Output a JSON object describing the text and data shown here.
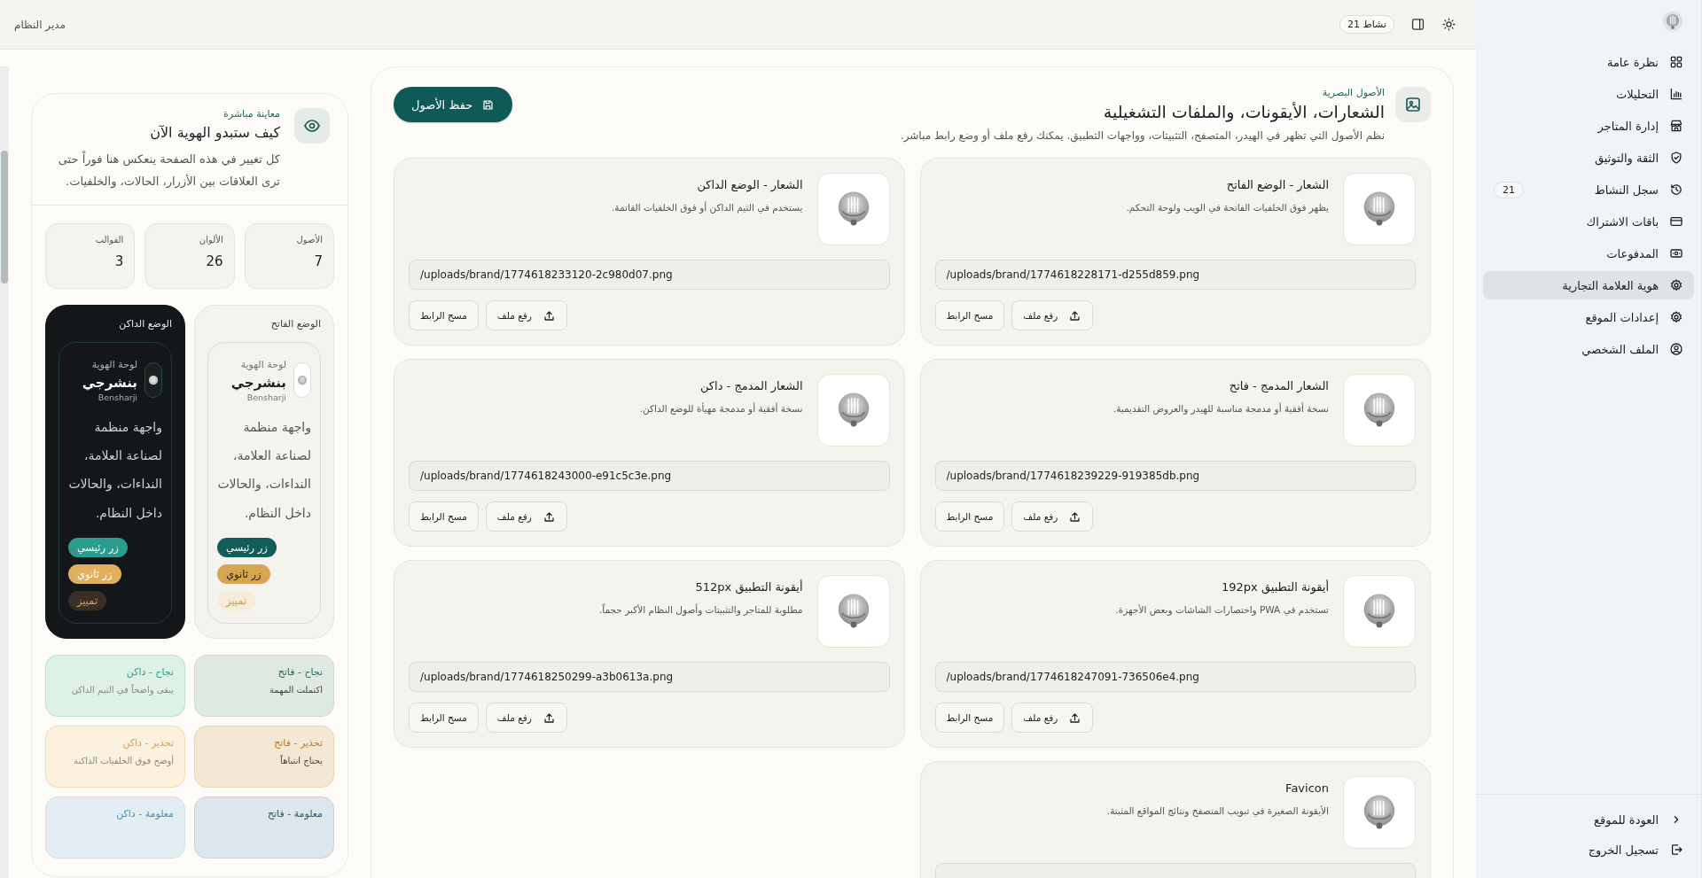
{
  "topbar": {
    "role": "مدير النظام",
    "activity_badge": "نشاط 21"
  },
  "sidebar": {
    "items": [
      {
        "label": "نظرة عامة",
        "selected": false
      },
      {
        "label": "التحليلات",
        "selected": false
      },
      {
        "label": "إدارة المتاجر",
        "selected": false
      },
      {
        "label": "الثقة والتوثيق",
        "selected": false
      },
      {
        "label": "سجل النشاط",
        "selected": false,
        "badge": "21"
      },
      {
        "label": "باقات الاشتراك",
        "selected": false
      },
      {
        "label": "المدفوعات",
        "selected": false
      },
      {
        "label": "هوية العلامة التجارية",
        "selected": true
      },
      {
        "label": "إعدادات الموقع",
        "selected": false
      },
      {
        "label": "الملف الشخصي",
        "selected": false
      }
    ],
    "footer": [
      {
        "label": "العودة للموقع"
      },
      {
        "label": "تسجيل الخروج"
      }
    ]
  },
  "assets_panel": {
    "eyebrow": "الأصول البصرية",
    "title": "الشعارات، الأيقونات، والملفات التشغيلية",
    "description": "نظم الأصول التي تظهر في الهيدر، المتصفح، التثبيتات، وواجهات التطبيق. يمكنك رفع ملف أو وضع رابط مباشر.",
    "save_button": "حفظ الأصول",
    "assets": [
      {
        "title": "الشعار - الوضع الفاتح",
        "description": "يظهر فوق الخلفيات الفاتحة في الويب ولوحة التحكم.",
        "url": "/uploads/brand/1774618228171-d255d859.png",
        "upload_label": "رفع ملف",
        "clear_label": "مسح الرابط"
      },
      {
        "title": "الشعار - الوضع الداكن",
        "description": "يستخدم في الثيم الداكن أو فوق الخلفيات القاتمة.",
        "url": "/uploads/brand/1774618233120-2c980d07.png",
        "upload_label": "رفع ملف",
        "clear_label": "مسح الرابط"
      },
      {
        "title": "الشعار المدمج - فاتح",
        "description": "نسخة أفقية أو مدمجة مناسبة للهيدر والعروض التقديمية.",
        "url": "/uploads/brand/1774618239229-919385db.png",
        "upload_label": "رفع ملف",
        "clear_label": "مسح الرابط"
      },
      {
        "title": "الشعار المدمج - داكن",
        "description": "نسخة أفقية أو مدمجة مهيأة للوضع الداكن.",
        "url": "/uploads/brand/1774618243000-e91c5c3e.png",
        "upload_label": "رفع ملف",
        "clear_label": "مسح الرابط"
      },
      {
        "title": "أيقونة التطبيق 192px",
        "description": "تستخدم في PWA واختصارات الشاشات وبعض الأجهزة.",
        "url": "/uploads/brand/1774618247091-736506e4.png",
        "upload_label": "رفع ملف",
        "clear_label": "مسح الرابط"
      },
      {
        "title": "أيقونة التطبيق 512px",
        "description": "مطلوبة للمتاجر والتثبيتات وأصول النظام الأكبر حجماً.",
        "url": "/uploads/brand/1774618250299-a3b0613a.png",
        "upload_label": "رفع ملف",
        "clear_label": "مسح الرابط"
      },
      {
        "title": "Favicon",
        "description": "الأيقونة الصغيرة في تبويب المتصفح ونتائج المواقع المثبتة."
      }
    ]
  },
  "preview": {
    "eyebrow": "معاينة مباشرة",
    "title": "كيف ستبدو الهوية الآن",
    "description": "كل تغيير في هذه الصفحة ينعكس هنا فوراً حتى ترى العلاقات بين الأزرار، الحالات، والخلفيات.",
    "stats": [
      {
        "label": "الأصول",
        "value": "7"
      },
      {
        "label": "الألوان",
        "value": "26"
      },
      {
        "label": "القوالب",
        "value": "3"
      }
    ],
    "modes": [
      {
        "kind": "light",
        "label": "الوضع الفاتح",
        "caption": "لوحة الهوية",
        "brand": "بنشرجي",
        "brand_latin": "Bensharji",
        "text": "واجهة منظمة لصناعة العلامة، النداءات، والحالات داخل النظام.",
        "buttons": [
          {
            "kind": "primary",
            "label": "زر رئيسي"
          },
          {
            "kind": "secondary",
            "label": "زر ثانوي"
          },
          {
            "kind": "accent",
            "label": "تمييز"
          }
        ]
      },
      {
        "kind": "dark",
        "label": "الوضع الداكن",
        "caption": "لوحة الهوية",
        "brand": "بنشرجي",
        "brand_latin": "Bensharji",
        "text": "واجهة منظمة لصناعة العلامة، النداءات، والحالات داخل النظام.",
        "buttons": [
          {
            "kind": "primary",
            "label": "زر رئيسي"
          },
          {
            "kind": "secondary",
            "label": "زر ثانوي"
          },
          {
            "kind": "accent",
            "label": "تمييز"
          }
        ]
      }
    ],
    "states": [
      {
        "kind": "success-light",
        "title": "نجاح - فاتح",
        "text": "اكتملت المهمة"
      },
      {
        "kind": "success-dark",
        "title": "نجاح - داكن",
        "text": "يبقى واضحاً في الثيم الداكن"
      },
      {
        "kind": "warning-light",
        "title": "تحذير - فاتح",
        "text": "يحتاج انتباهاً"
      },
      {
        "kind": "warning-dark",
        "title": "تحذير - داكن",
        "text": "أوضح فوق الخلفيات الداكنة"
      },
      {
        "kind": "info-light",
        "title": "معلومة - فاتح"
      },
      {
        "kind": "info-dark",
        "title": "معلومة - داكن"
      }
    ]
  }
}
